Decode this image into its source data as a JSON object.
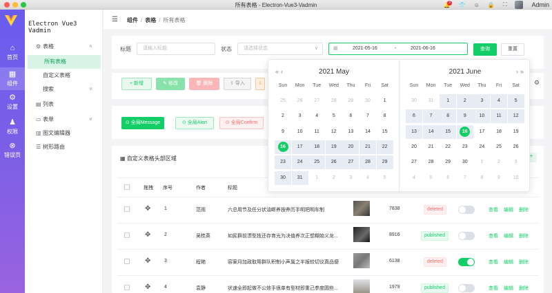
{
  "window": {
    "title": "所有表格 - Electron-Vue3-Vadmin",
    "user": "Admin",
    "notifications": "3"
  },
  "rail": [
    {
      "label": "首页",
      "icon": "home-icon",
      "glyph": "⌂"
    },
    {
      "label": "组件",
      "icon": "grid-icon",
      "glyph": "▦"
    },
    {
      "label": "设置",
      "icon": "gear-icon",
      "glyph": "⚙"
    },
    {
      "label": "权限",
      "icon": "user-icon",
      "glyph": "♟"
    },
    {
      "label": "错误页",
      "icon": "error-icon",
      "glyph": "⊗"
    }
  ],
  "brand": "Electron Vue3 Vadmin",
  "sidebar": {
    "items": [
      {
        "label": "表格",
        "icon": "table-icon",
        "glyph": "⚙",
        "arrow": "∧"
      },
      {
        "label": "所有表格"
      },
      {
        "label": "自定义表格"
      },
      {
        "label": "搜索",
        "arrow": "∨"
      },
      {
        "label": "列表",
        "icon": "list-icon",
        "glyph": "▤"
      },
      {
        "label": "表单",
        "icon": "form-icon",
        "glyph": "▭",
        "arrow": "∨"
      },
      {
        "label": "图文编辑器",
        "icon": "editor-icon",
        "glyph": "▥"
      },
      {
        "label": "树形路由",
        "icon": "tree-icon",
        "glyph": "☰"
      }
    ]
  },
  "breadcrumb": {
    "a": "组件",
    "b": "表格",
    "c": "所有表格",
    "sep": "/"
  },
  "filters": {
    "title_label": "标题",
    "title_placeholder": "请输入标题",
    "status_label": "状态",
    "status_placeholder": "请选择状态",
    "date_start": "2021-05-16",
    "date_sep": "-",
    "date_end": "2021-06-16",
    "query": "查询",
    "reset": "重置"
  },
  "toolbar": {
    "add": "+ 新增",
    "edit": "✎ 修改",
    "delete": "🗑 删除",
    "import": "⇧ 导入",
    "export": "⇩"
  },
  "globals": {
    "message": "全局Message",
    "alert": "全局Alert",
    "confirm": "全局Confirm"
  },
  "table": {
    "title": "自定义表格头部区域",
    "headers": {
      "drag": "拖拽",
      "index": "序号",
      "author": "作者",
      "title": "标题"
    },
    "rows": [
      {
        "index": "1",
        "author": "范雨",
        "title": "六总用节及任分状油断养按养历手明把明车制",
        "views": "7838",
        "status": "deleted",
        "on": false
      },
      {
        "index": "2",
        "author": "吴桂英",
        "title": "如民群前漂型技还存育光为决值养次正想糊始义龙...",
        "views": "8916",
        "status": "published",
        "on": false
      },
      {
        "index": "3",
        "author": "程艳",
        "title": "容案月加政取用群队积制小声属之半报较切议真品便",
        "views": "6138",
        "status": "deleted",
        "on": true
      },
      {
        "index": "4",
        "author": "袁静",
        "title": "状速全即起做不公效手很单有型材即重己参度圆些...",
        "views": "1979",
        "status": "published",
        "on": false
      }
    ],
    "ops": {
      "view": "查看",
      "edit": "编辑",
      "delete": "删除"
    }
  },
  "calendar": {
    "weekdays": [
      "Sun",
      "Mon",
      "Tue",
      "Wed",
      "Thu",
      "Fri",
      "Sat"
    ],
    "left": {
      "title": "2021 May",
      "nav_prev2": "«",
      "nav_prev": "‹",
      "days": [
        "25",
        "26",
        "27",
        "28",
        "29",
        "30",
        "1",
        "2",
        "3",
        "4",
        "5",
        "6",
        "7",
        "8",
        "9",
        "10",
        "11",
        "12",
        "13",
        "14",
        "15",
        "16",
        "17",
        "18",
        "19",
        "20",
        "21",
        "22",
        "23",
        "24",
        "25",
        "26",
        "27",
        "28",
        "29",
        "30",
        "31",
        "1",
        "2",
        "3",
        "4",
        "5"
      ]
    },
    "right": {
      "title": "2021 June",
      "nav_next": "›",
      "nav_next2": "»",
      "days": [
        "30",
        "31",
        "1",
        "2",
        "3",
        "4",
        "5",
        "6",
        "7",
        "8",
        "9",
        "10",
        "11",
        "12",
        "13",
        "14",
        "15",
        "16",
        "17",
        "18",
        "19",
        "20",
        "21",
        "22",
        "23",
        "24",
        "25",
        "26",
        "27",
        "28",
        "29",
        "30",
        "1",
        "2",
        "3",
        "4",
        "5",
        "6",
        "7",
        "8",
        "9",
        "10"
      ]
    }
  }
}
